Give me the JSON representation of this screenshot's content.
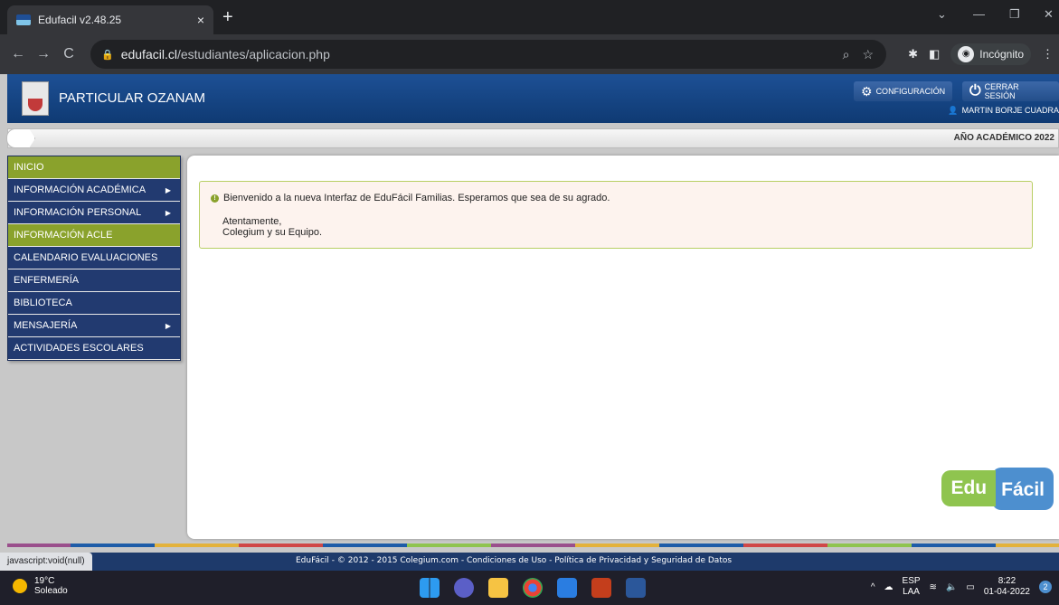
{
  "browser": {
    "tab_title": "Edufacil v2.48.25",
    "tab_close": "×",
    "new_tab": "+",
    "url_domain": "edufacil.cl",
    "url_path": "/estudiantes/aplicacion.php",
    "incognito_label": "Incógnito",
    "status_url": "javascript:void(null)"
  },
  "header": {
    "school_name": "PARTICULAR OZANAM",
    "config_label": "CONFIGURACIÓN",
    "logout_label": "CERRAR SESIÓN",
    "user_name": "MARTIN BORJE CUADRA"
  },
  "subbar": {
    "year_label": "AÑO ACADÉMICO  2022"
  },
  "sidebar": {
    "items": [
      {
        "label": "INICIO",
        "active": true,
        "submenu": false
      },
      {
        "label": "INFORMACIÓN ACADÉMICA",
        "active": false,
        "submenu": true
      },
      {
        "label": "INFORMACIÓN PERSONAL",
        "active": false,
        "submenu": true
      },
      {
        "label": "INFORMACIÓN ACLE",
        "active": true,
        "submenu": false
      },
      {
        "label": "CALENDARIO EVALUACIONES",
        "active": false,
        "submenu": false
      },
      {
        "label": "ENFERMERÍA",
        "active": false,
        "submenu": false
      },
      {
        "label": "BIBLIOTECA",
        "active": false,
        "submenu": false
      },
      {
        "label": "MENSAJERÍA",
        "active": false,
        "submenu": true
      },
      {
        "label": "ACTIVIDADES ESCOLARES",
        "active": false,
        "submenu": false
      }
    ]
  },
  "notice": {
    "message": "Bienvenido a la nueva Interfaz de EduFácil Familias. Esperamos que sea de su agrado.",
    "sign_line1": "Atentamente,",
    "sign_line2": "Colegium y su Equipo."
  },
  "brand_logo": {
    "part1": "Edu",
    "part2": "Fácil"
  },
  "footer": {
    "copyright": "EduFácil - © 2012 - 2015 Colegium.com - Condiciones de Uso - Política de Privacidad y Seguridad de Datos"
  },
  "taskbar": {
    "temperature": "19°C",
    "weather": "Soleado",
    "lang_top": "ESP",
    "lang_bottom": "LAA",
    "time": "8:22",
    "date": "01-04-2022",
    "notifications": "2"
  },
  "colors": {
    "header_blue": "#1d5095",
    "menu_green": "#8aa22c",
    "menu_blue": "#223a70",
    "notice_border": "#b8cf65"
  }
}
